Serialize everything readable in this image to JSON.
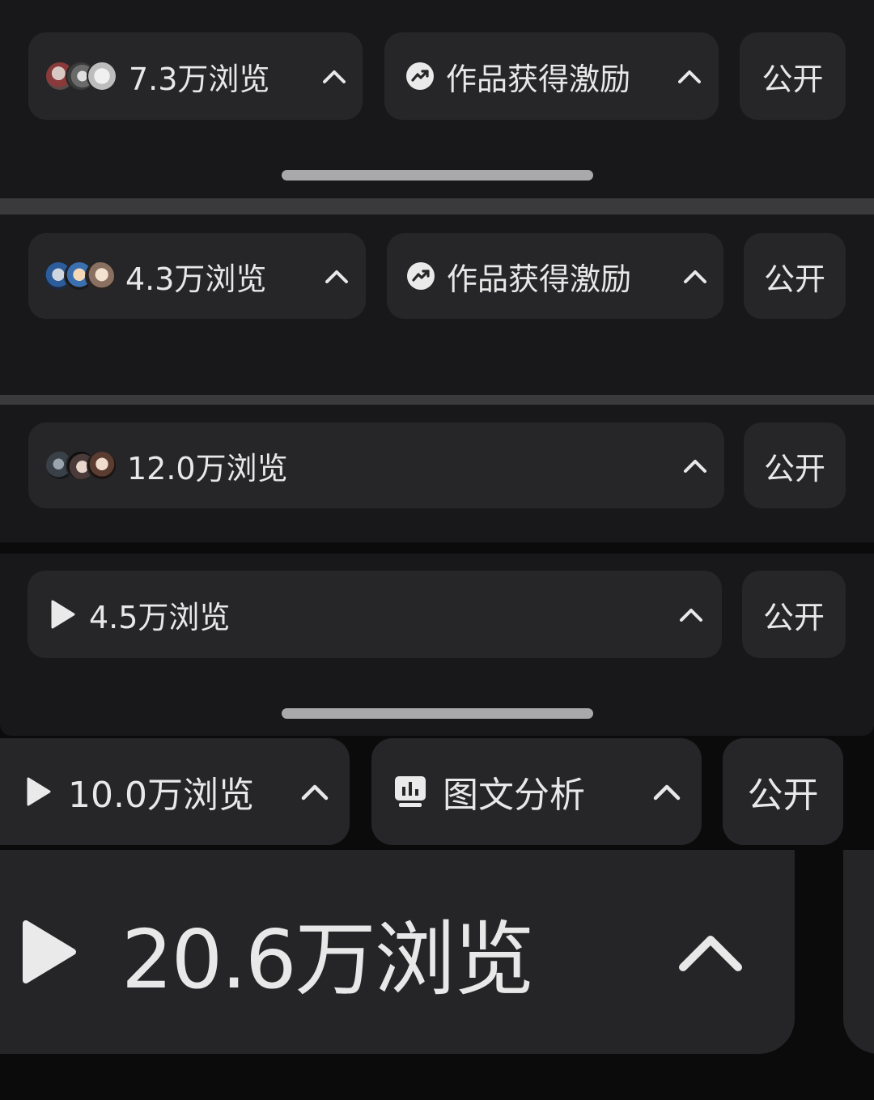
{
  "rows": [
    {
      "views": "7.3万浏览",
      "incentive": "作品获得激励",
      "visibility": "公开",
      "icon": "avatar-stack"
    },
    {
      "views": "4.3万浏览",
      "incentive": "作品获得激励",
      "visibility": "公开",
      "icon": "avatar-stack"
    },
    {
      "views": "12.0万浏览",
      "visibility": "公开",
      "icon": "avatar-stack"
    },
    {
      "views": "4.5万浏览",
      "visibility": "公开",
      "icon": "play-icon"
    },
    {
      "views": "10.0万浏览",
      "analysis": "图文分析",
      "visibility": "公开",
      "icon": "play-icon"
    },
    {
      "views": "20.6万浏览",
      "icon": "play-icon"
    }
  ],
  "icons": {
    "expand": "chevron-up-icon",
    "incentive": "trending-up-icon",
    "analysis": "bar-chart-icon",
    "play": "play-icon"
  },
  "colors": {
    "background": "#0b0b0c",
    "panel": "#18181a",
    "pill": "#262628",
    "text": "#e8e8e8",
    "handle": "#a9a9ab"
  }
}
